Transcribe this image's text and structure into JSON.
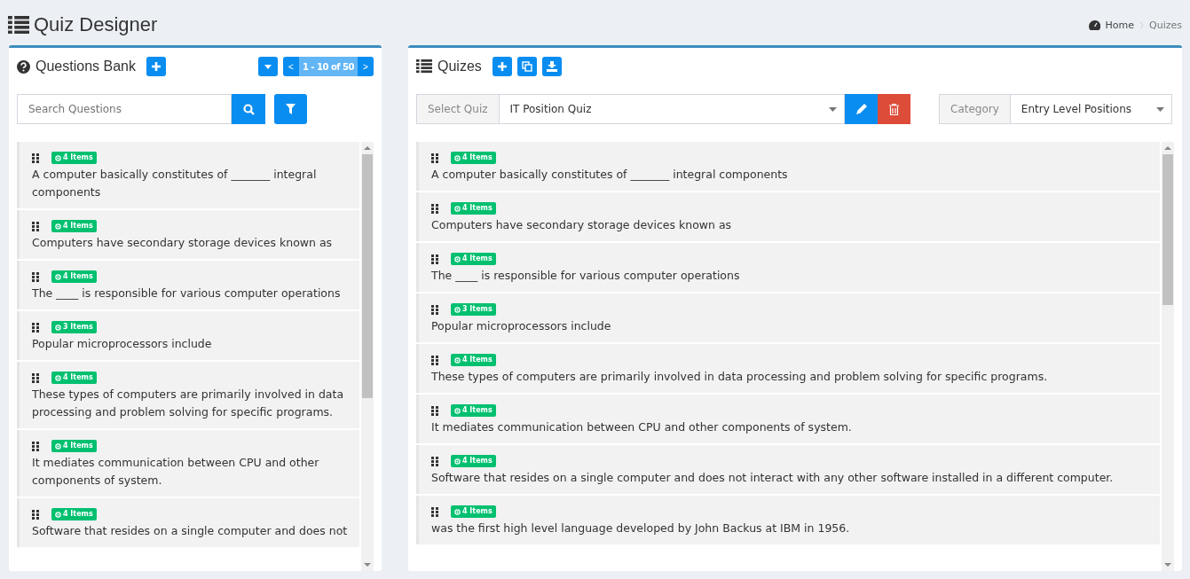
{
  "page": {
    "title": "Quiz Designer",
    "breadcrumb": [
      "Home",
      "Quizes"
    ]
  },
  "questions_bank": {
    "title": "Questions Bank",
    "pager": {
      "prev": "<",
      "range": "1 - 10 of 50",
      "next": ">"
    },
    "search": {
      "placeholder": "Search Questions"
    },
    "questions": [
      {
        "badge": "4 Items",
        "text": "A computer basically constitutes of _______ integral components"
      },
      {
        "badge": "4 Items",
        "text": "Computers have secondary storage devices known as"
      },
      {
        "badge": "4 Items",
        "text": "The ____ is responsible for various computer operations"
      },
      {
        "badge": "3 Items",
        "text": "Popular microprocessors include"
      },
      {
        "badge": "4 Items",
        "text": "These types of computers are primarily involved in data processing and problem solving for specific programs."
      },
      {
        "badge": "4 Items",
        "text": "It mediates communication between CPU and other components of system."
      },
      {
        "badge": "4 Items",
        "text": "Software that resides on a single computer and does not"
      }
    ]
  },
  "quizes": {
    "title": "Quizes",
    "select_quiz": {
      "label": "Select Quiz",
      "value": "IT Position Quiz"
    },
    "category": {
      "label": "Category",
      "value": "Entry Level Positions"
    },
    "questions": [
      {
        "badge": "4 Items",
        "text": "A computer basically constitutes of _______ integral components"
      },
      {
        "badge": "4 Items",
        "text": "Computers have secondary storage devices known as"
      },
      {
        "badge": "4 Items",
        "text": "The ____ is responsible for various computer operations"
      },
      {
        "badge": "3 Items",
        "text": "Popular microprocessors include"
      },
      {
        "badge": "4 Items",
        "text": "These types of computers are primarily involved in data processing and problem solving for specific programs."
      },
      {
        "badge": "4 Items",
        "text": "It mediates communication between CPU and other components of system."
      },
      {
        "badge": "4 Items",
        "text": "Software that resides on a single computer and does not interact with any other software installed in a different computer."
      },
      {
        "badge": "4 Items",
        "text": "was the first high level language developed by John Backus at IBM in 1956."
      }
    ]
  }
}
